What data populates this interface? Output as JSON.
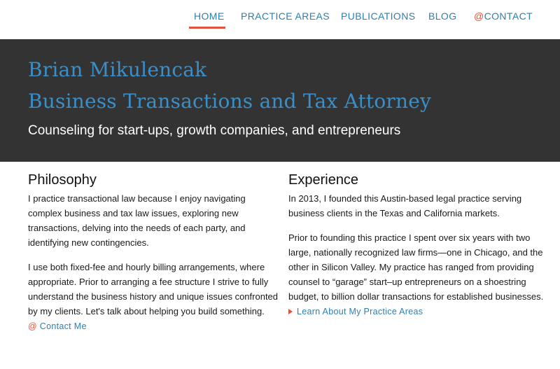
{
  "nav": {
    "items": [
      {
        "label": "HOME",
        "active": true
      },
      {
        "label": "PRACTICE AREAS"
      },
      {
        "label": "PUBLICATIONS"
      },
      {
        "label": "BLOG"
      },
      {
        "label": "CONTACT",
        "prefix": "@"
      }
    ]
  },
  "hero": {
    "name": "Brian Mikulencak",
    "role": "Business Transactions and Tax Attorney",
    "tagline": "Counseling for start-ups, growth companies, and entrepreneurs"
  },
  "philosophy": {
    "heading": "Philosophy",
    "paragraphs": [
      "I practice transactional law because I enjoy navigating complex business and tax law issues, exploring new transactions, delving into the needs of each party, and identifying new contingencies.",
      "I use both fixed-fee and hourly billing arrangements, where appropriate. Prior to arranging a fee structure I strive to fully understand the business history and unique issues confronted by my clients. Let's talk about helping you build something."
    ],
    "link_prefix": "@",
    "link_label": "Contact Me"
  },
  "experience": {
    "heading": "Experience",
    "paragraphs": [
      "In 2013, I founded this Austin-based legal practice serving business clients in the Texas and California markets.",
      "Prior to founding this practice I spent over six years with two large, nationally recognized law firms—one in Chicago, and the other in Silicon Valley. My practice has ranged from providing counsel to “garage” start–up entrepreneurs on a shoestring budget, to billion dollar transactions for established businesses."
    ],
    "link_label": "Learn About My Practice Areas"
  },
  "colors": {
    "accent_blue": "#2d7fb0",
    "accent_red": "#e0533c",
    "hero_bg": "#333333"
  }
}
